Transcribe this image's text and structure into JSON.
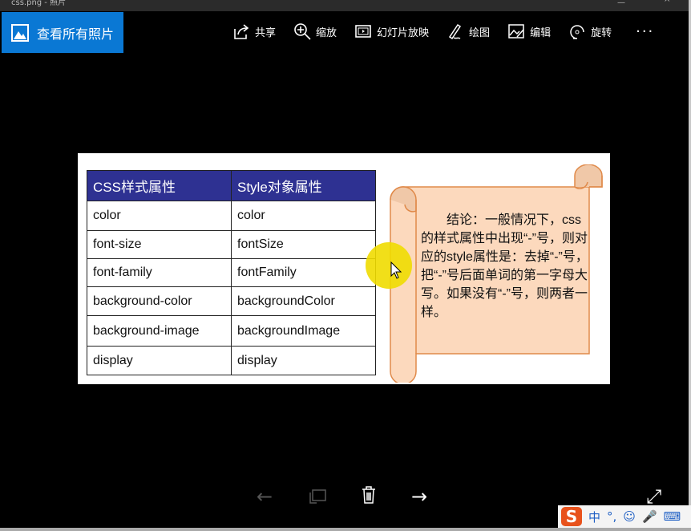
{
  "window": {
    "title": "css.png - 照片"
  },
  "back_button": {
    "label": "查看所有照片"
  },
  "toolbar": [
    {
      "label": "共享",
      "icon": "share-icon"
    },
    {
      "label": "缩放",
      "icon": "zoom-icon"
    },
    {
      "label": "幻灯片放映",
      "icon": "slideshow-icon"
    },
    {
      "label": "绘图",
      "icon": "draw-icon"
    },
    {
      "label": "编辑",
      "icon": "edit-icon"
    },
    {
      "label": "旋转",
      "icon": "rotate-icon"
    }
  ],
  "more": "···",
  "slide": {
    "table": {
      "headers": [
        "CSS样式属性",
        "Style对象属性"
      ],
      "rows": [
        [
          "color",
          "color"
        ],
        [
          "font-size",
          "fontSize"
        ],
        [
          "font-family",
          "fontFamily"
        ],
        [
          "background-color",
          "backgroundColor"
        ],
        [
          "background-image",
          "backgroundImage"
        ],
        [
          "display",
          "display"
        ]
      ]
    },
    "note": "结论：一般情况下，css的样式属性中出现“-”号，则对应的style属性是：去掉“-”号，把“-”号后面单词的第一字母大写。如果没有“-”号，则两者一样。"
  },
  "ime": {
    "logo": "S",
    "mode": "中",
    "punct": "°,",
    "emoji": "☺",
    "mic": "🎤",
    "keyboard": "⌨"
  }
}
